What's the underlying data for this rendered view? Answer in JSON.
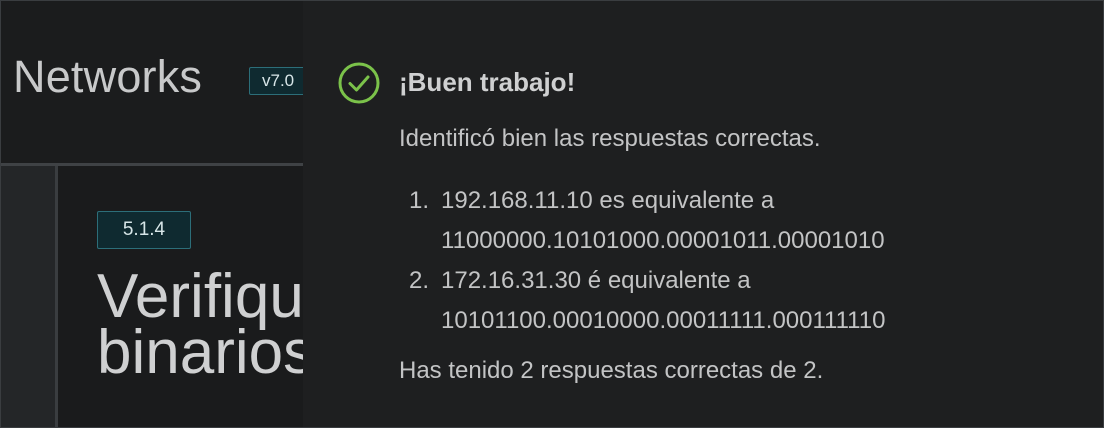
{
  "background_page": {
    "app_title": "Networks",
    "version_badge": "v7.0",
    "section_number": "5.1.4",
    "heading": "Verifique\nbinarios"
  },
  "feedback": {
    "icon": "check-circle-icon",
    "title": "¡Buen trabajo!",
    "message": "Identificó bien las respuestas correctas.",
    "answers": [
      {
        "number": "1.",
        "line1": "192.168.11.10 es equivalente a",
        "line2": "11000000.10101000.00001011.00001010"
      },
      {
        "number": "2.",
        "line1": "172.16.31.30 é equivalente a",
        "line2": "10101100.00010000.00011111.000111110"
      }
    ],
    "score": "Has tenido 2 respuestas correctas de 2."
  },
  "colors": {
    "success": "#7bc24a",
    "badge_border": "#2c6e79",
    "badge_fill": "#0f2a30",
    "panel_bg": "#1e1f20"
  }
}
